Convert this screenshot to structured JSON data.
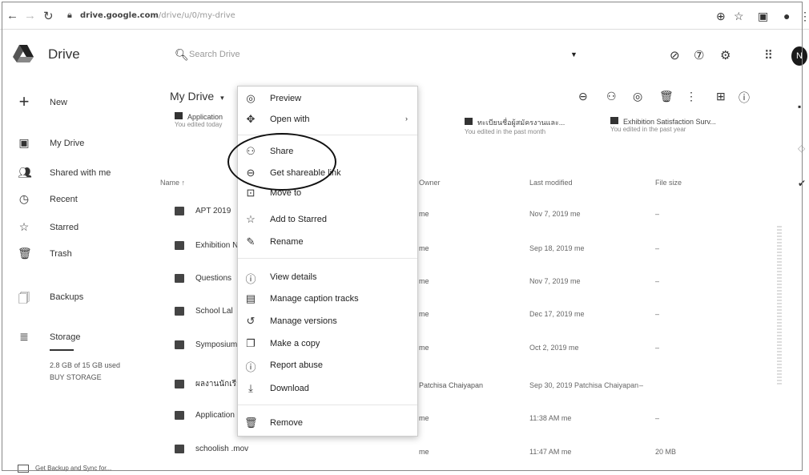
{
  "browser": {
    "url_host": "drive.google.com",
    "url_path": "/drive/u/0/my-drive"
  },
  "header": {
    "app_title": "Drive",
    "search_placeholder": "Search Drive",
    "avatar_letter": "N"
  },
  "sidebar": {
    "new_label": "New",
    "items": [
      {
        "label": "My Drive",
        "icon": "drive-icon"
      },
      {
        "label": "Shared with me",
        "icon": "people-icon"
      },
      {
        "label": "Recent",
        "icon": "clock-icon"
      },
      {
        "label": "Starred",
        "icon": "star-icon"
      },
      {
        "label": "Trash",
        "icon": "trash-icon"
      },
      {
        "label": "Backups",
        "icon": "backup-icon"
      },
      {
        "label": "Storage",
        "icon": "storage-icon"
      }
    ],
    "storage_used": "2.8 GB of 15 GB used",
    "buy_storage": "BUY STORAGE"
  },
  "main": {
    "breadcrumb": "My Drive",
    "quick_access": [
      {
        "name": "Application",
        "sub": "You edited today"
      },
      {
        "name": "ทะเบียนชื่อผู้สมัครงานและ...",
        "sub": "You edited in the past month"
      },
      {
        "name": "Exhibition Satisfaction Surv...",
        "sub": "You edited in the past year"
      }
    ],
    "columns": {
      "name": "Name",
      "owner": "Owner",
      "modified": "Last modified",
      "size": "File size"
    },
    "rows": [
      {
        "name": "APT 2019",
        "owner": "me",
        "modified": "Nov 7, 2019 me",
        "size": "–"
      },
      {
        "name": "Exhibition N",
        "owner": "me",
        "modified": "Sep 18, 2019 me",
        "size": "–"
      },
      {
        "name": "Questions",
        "owner": "me",
        "modified": "Nov 7, 2019 me",
        "size": "–"
      },
      {
        "name": "School Lal",
        "owner": "me",
        "modified": "Dec 17, 2019 me",
        "size": "–"
      },
      {
        "name": "Symposium",
        "owner": "me",
        "modified": "Oct 2, 2019 me",
        "size": "–"
      },
      {
        "name": "ผลงานนักเรียน",
        "owner": "Patchisa Chaiyapan",
        "modified": "Sep 30, 2019 Patchisa Chaiyapan",
        "size": "–"
      },
      {
        "name": "Application",
        "owner": "me",
        "modified": "11:38 AM me",
        "size": "–"
      },
      {
        "name": "schoolish .mov",
        "owner": "me",
        "modified": "11:47 AM me",
        "size": "20 MB"
      }
    ]
  },
  "context_menu": {
    "items": [
      {
        "label": "Preview",
        "icon": "eye-icon"
      },
      {
        "label": "Open with",
        "icon": "move-arrows-icon"
      },
      {
        "label": "Share",
        "icon": "add-person-icon"
      },
      {
        "label": "Get shareable link",
        "icon": "link-icon"
      },
      {
        "label": "Move to",
        "icon": "folder-move-icon"
      },
      {
        "label": "Add to Starred",
        "icon": "star-icon"
      },
      {
        "label": "Rename",
        "icon": "pencil-icon"
      },
      {
        "label": "View details",
        "icon": "info-icon"
      },
      {
        "label": "Manage caption tracks",
        "icon": "caption-icon"
      },
      {
        "label": "Manage versions",
        "icon": "history-icon"
      },
      {
        "label": "Make a copy",
        "icon": "copy-icon"
      },
      {
        "label": "Report abuse",
        "icon": "report-icon"
      },
      {
        "label": "Download",
        "icon": "download-icon"
      },
      {
        "label": "Remove",
        "icon": "trash-icon"
      }
    ]
  },
  "bottom_bar": {
    "label": "Get Backup and Sync for..."
  }
}
